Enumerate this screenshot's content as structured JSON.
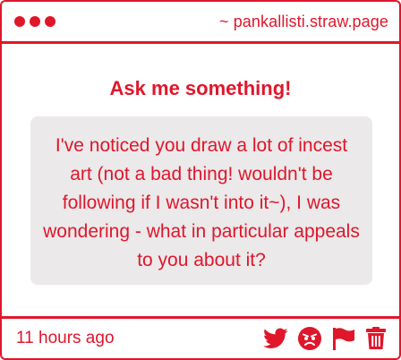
{
  "window": {
    "address": "~ pankallisti.straw.page"
  },
  "main": {
    "heading": "Ask me something!",
    "question": "I've noticed you draw a lot of incest art (not a bad thing! wouldn't be following if I wasn't into it~), I was wondering - what in particular appeals to you about it?"
  },
  "footer": {
    "timestamp": "11 hours ago",
    "icons": [
      "twitter-icon",
      "angry-face-icon",
      "flag-icon",
      "trash-icon"
    ]
  },
  "colors": {
    "accent": "#e0162b",
    "bubble": "#ebe9ea"
  }
}
